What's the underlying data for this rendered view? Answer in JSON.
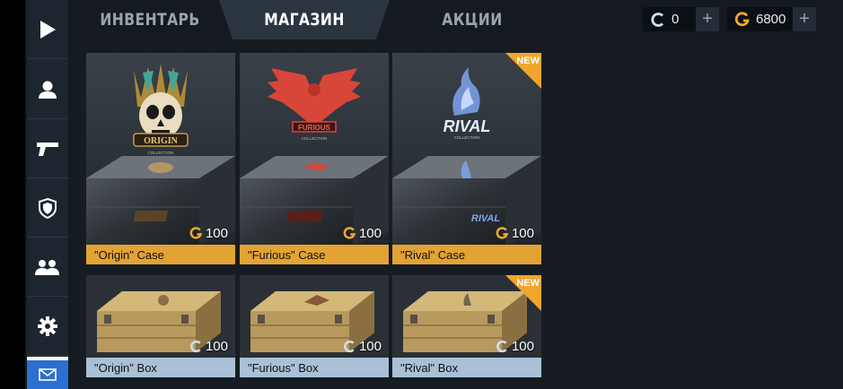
{
  "tabs": [
    {
      "label": "ИНВЕНТАРЬ",
      "active": false
    },
    {
      "label": "МАГАЗИН",
      "active": true
    },
    {
      "label": "АКЦИИ",
      "active": false
    }
  ],
  "currency": {
    "silver": {
      "value": "0",
      "icon": "silver-coin-icon"
    },
    "gold": {
      "value": "6800",
      "icon": "gold-coin-icon"
    },
    "plus_symbol": "+"
  },
  "sidebar": {
    "items": [
      {
        "icon": "play-icon"
      },
      {
        "icon": "profile-icon"
      },
      {
        "icon": "pistol-icon"
      },
      {
        "icon": "shield-icon"
      },
      {
        "icon": "friends-icon"
      },
      {
        "icon": "gear-icon"
      },
      {
        "icon": "mail-icon"
      }
    ]
  },
  "shop": {
    "cases": [
      {
        "name": "\"Origin\" Case",
        "price": "100",
        "currency": "gold",
        "is_new": false,
        "accent": "#d9b36a"
      },
      {
        "name": "\"Furious\" Case",
        "price": "100",
        "currency": "gold",
        "is_new": false,
        "accent": "#d94a3a"
      },
      {
        "name": "\"Rival\" Case",
        "price": "100",
        "currency": "gold",
        "is_new": true,
        "accent": "#7fa4ee"
      }
    ],
    "boxes": [
      {
        "name": "\"Origin\" Box",
        "price": "100",
        "currency": "silver",
        "is_new": false
      },
      {
        "name": "\"Furious\" Box",
        "price": "100",
        "currency": "silver",
        "is_new": false
      },
      {
        "name": "\"Rival\" Box",
        "price": "100",
        "currency": "silver",
        "is_new": true
      }
    ],
    "new_badge": "NEW",
    "case_art": {
      "origin_logo": "ORIGIN",
      "origin_sub": "COLLECTION",
      "furious_logo": "FURIOUS",
      "furious_sub": "COLLECTION",
      "rival_logo": "RIVAL",
      "rival_sub": "COLLECTION"
    }
  },
  "colors": {
    "gold": "#e3a234",
    "silver_label": "#a9c0d6",
    "mail_accent": "#2b6fd1"
  }
}
